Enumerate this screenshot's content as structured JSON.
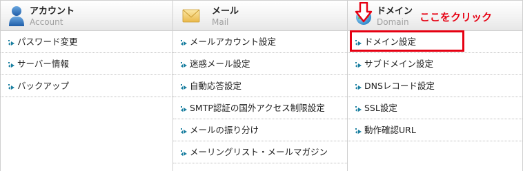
{
  "columns": [
    {
      "title": "アカウント",
      "subtitle": "Account",
      "icon": "user-icon",
      "items": [
        "パスワード変更",
        "サーバー情報",
        "バックアップ"
      ]
    },
    {
      "title": "メール",
      "subtitle": "Mail",
      "icon": "envelope-icon",
      "items": [
        "メールアカウント設定",
        "迷惑メール設定",
        "自動応答設定",
        "SMTP認証の国外アクセス制限設定",
        "メールの振り分け",
        "メーリングリスト・メールマガジン"
      ]
    },
    {
      "title": "ドメイン",
      "subtitle": "Domain",
      "icon": "globe-icon",
      "items": [
        "ドメイン設定",
        "サブドメイン設定",
        "DNSレコード設定",
        "SSL設定",
        "動作確認URL"
      ]
    }
  ],
  "annotation": {
    "text": "ここをクリック",
    "color": "#e60012"
  },
  "colors": {
    "bullet": "#1a7fa0",
    "border": "#cfcfcf",
    "highlight": "#e60012"
  }
}
